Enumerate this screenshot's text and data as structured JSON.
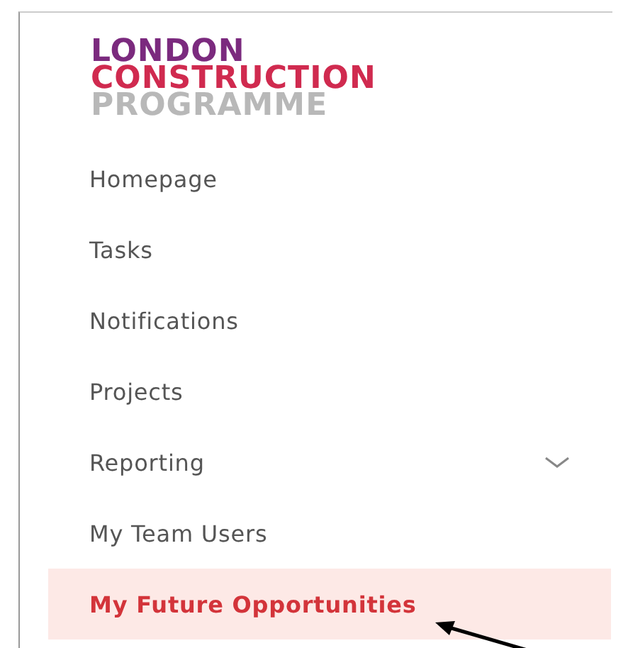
{
  "logo": {
    "lines": [
      {
        "text": "LONDON",
        "color": "#7b2a7e"
      },
      {
        "text": "CONSTRUCTION",
        "color": "#d02a4f"
      },
      {
        "text": "PROGRAMME",
        "color": "#b8b8b8"
      }
    ]
  },
  "sidebar": {
    "items": [
      {
        "label": "Homepage",
        "selected": false,
        "has_submenu": false
      },
      {
        "label": "Tasks",
        "selected": false,
        "has_submenu": false
      },
      {
        "label": "Notifications",
        "selected": false,
        "has_submenu": false
      },
      {
        "label": "Projects",
        "selected": false,
        "has_submenu": false
      },
      {
        "label": "Reporting",
        "selected": false,
        "has_submenu": true
      },
      {
        "label": "My Team Users",
        "selected": false,
        "has_submenu": false
      },
      {
        "label": "My Future Opportunities",
        "selected": true,
        "has_submenu": false
      }
    ]
  }
}
